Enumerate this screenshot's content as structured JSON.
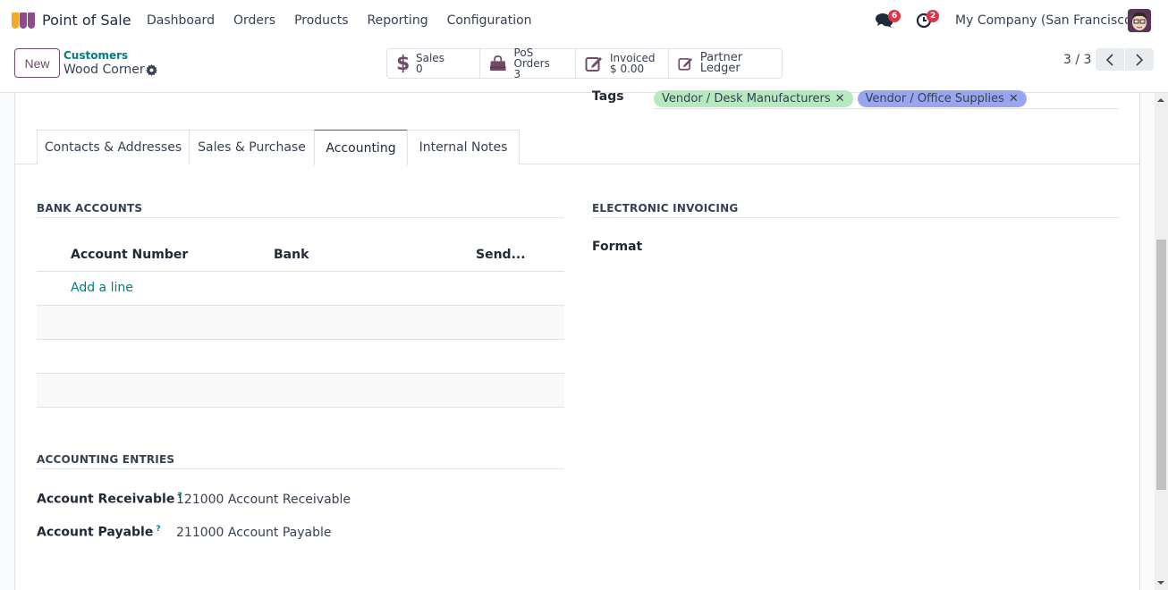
{
  "navbar": {
    "app_title": "Point of Sale",
    "menu": [
      "Dashboard",
      "Orders",
      "Products",
      "Reporting",
      "Configuration"
    ],
    "messages_count": "6",
    "activities_count": "2",
    "company": "My Company (San Francisco)"
  },
  "control": {
    "new_label": "New",
    "breadcrumb_parent": "Customers",
    "breadcrumb_current": "Wood Corner",
    "smart_buttons": [
      {
        "label": "Sales",
        "value": "0",
        "icon": "dollar-icon"
      },
      {
        "label": "PoS Orders",
        "value": "3",
        "icon": "shopping-bag-icon"
      },
      {
        "label": "Invoiced",
        "value": "$ 0.00",
        "icon": "edit-icon"
      },
      {
        "label": "Partner Ledger",
        "value": "",
        "icon": "edit-icon"
      }
    ],
    "pager": "3 / 3"
  },
  "form": {
    "tags_label": "Tags",
    "tags": [
      {
        "label": "Vendor / Desk Manufacturers",
        "color": "#b7e9c1"
      },
      {
        "label": "Vendor / Office Supplies",
        "color": "#98a6f0"
      }
    ],
    "tabs": [
      "Contacts & Addresses",
      "Sales & Purchase",
      "Accounting",
      "Internal Notes"
    ],
    "active_tab": "Accounting",
    "bank_accounts": {
      "title": "BANK ACCOUNTS",
      "columns": [
        "Account Number",
        "Bank",
        "Send..."
      ],
      "add_line": "Add a line"
    },
    "electronic_invoicing": {
      "title": "ELECTRONIC INVOICING",
      "format_label": "Format",
      "format_value": ""
    },
    "accounting_entries": {
      "title": "ACCOUNTING ENTRIES",
      "receivable_label": "Account Receivable",
      "receivable_value": "121000 Account Receivable",
      "payable_label": "Account Payable",
      "payable_value": "211000 Account Payable",
      "help_glyph": "?"
    }
  },
  "colors": {
    "brand": "#714b67",
    "link": "#017e84",
    "badge": "#dc3545"
  }
}
